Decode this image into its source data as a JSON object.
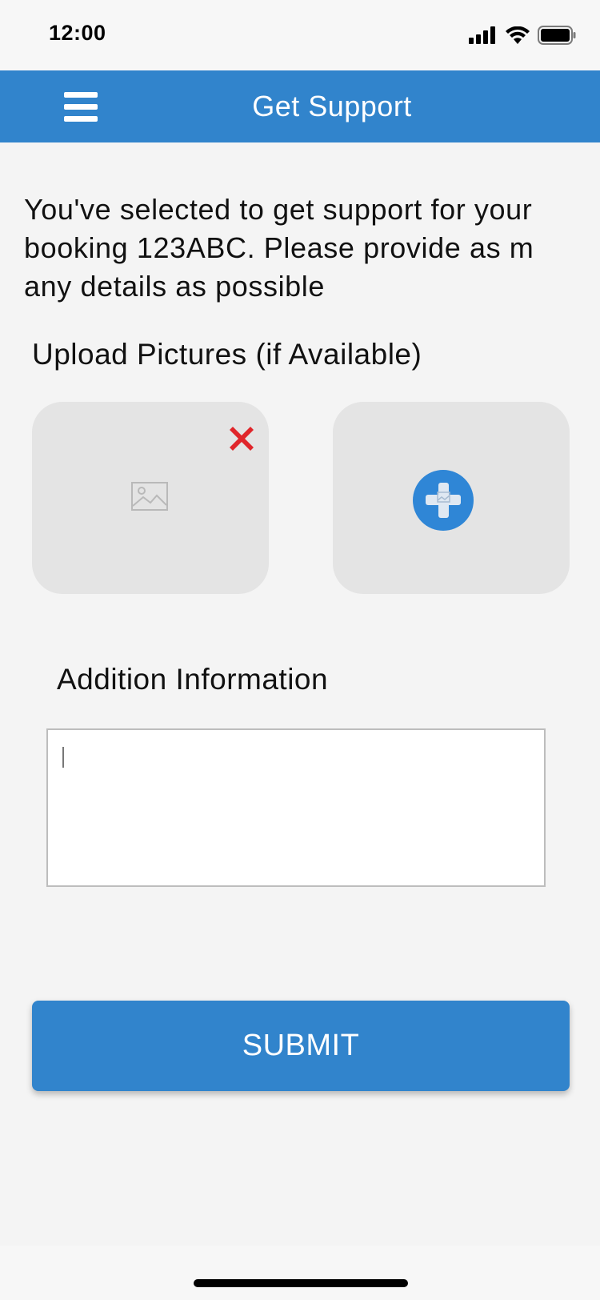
{
  "status_bar": {
    "time": "12:00"
  },
  "header": {
    "title": "Get Support"
  },
  "intro": {
    "text": "You've selected to get support for your booking 123ABC. Please provide as m any details as possible"
  },
  "upload": {
    "heading": "Upload Pictures (if Available)"
  },
  "additional": {
    "heading": "Addition Information",
    "value": ""
  },
  "submit": {
    "label": "SUBMIT"
  },
  "colors": {
    "primary": "#3184cc",
    "tile": "#e4e4e4",
    "remove": "#e0262b",
    "add_button": "#2f86d6"
  },
  "icons": {
    "menu": "hamburger-menu-icon",
    "remove": "red-x-icon",
    "image": "image-placeholder-icon",
    "add": "plus-circle-icon"
  }
}
